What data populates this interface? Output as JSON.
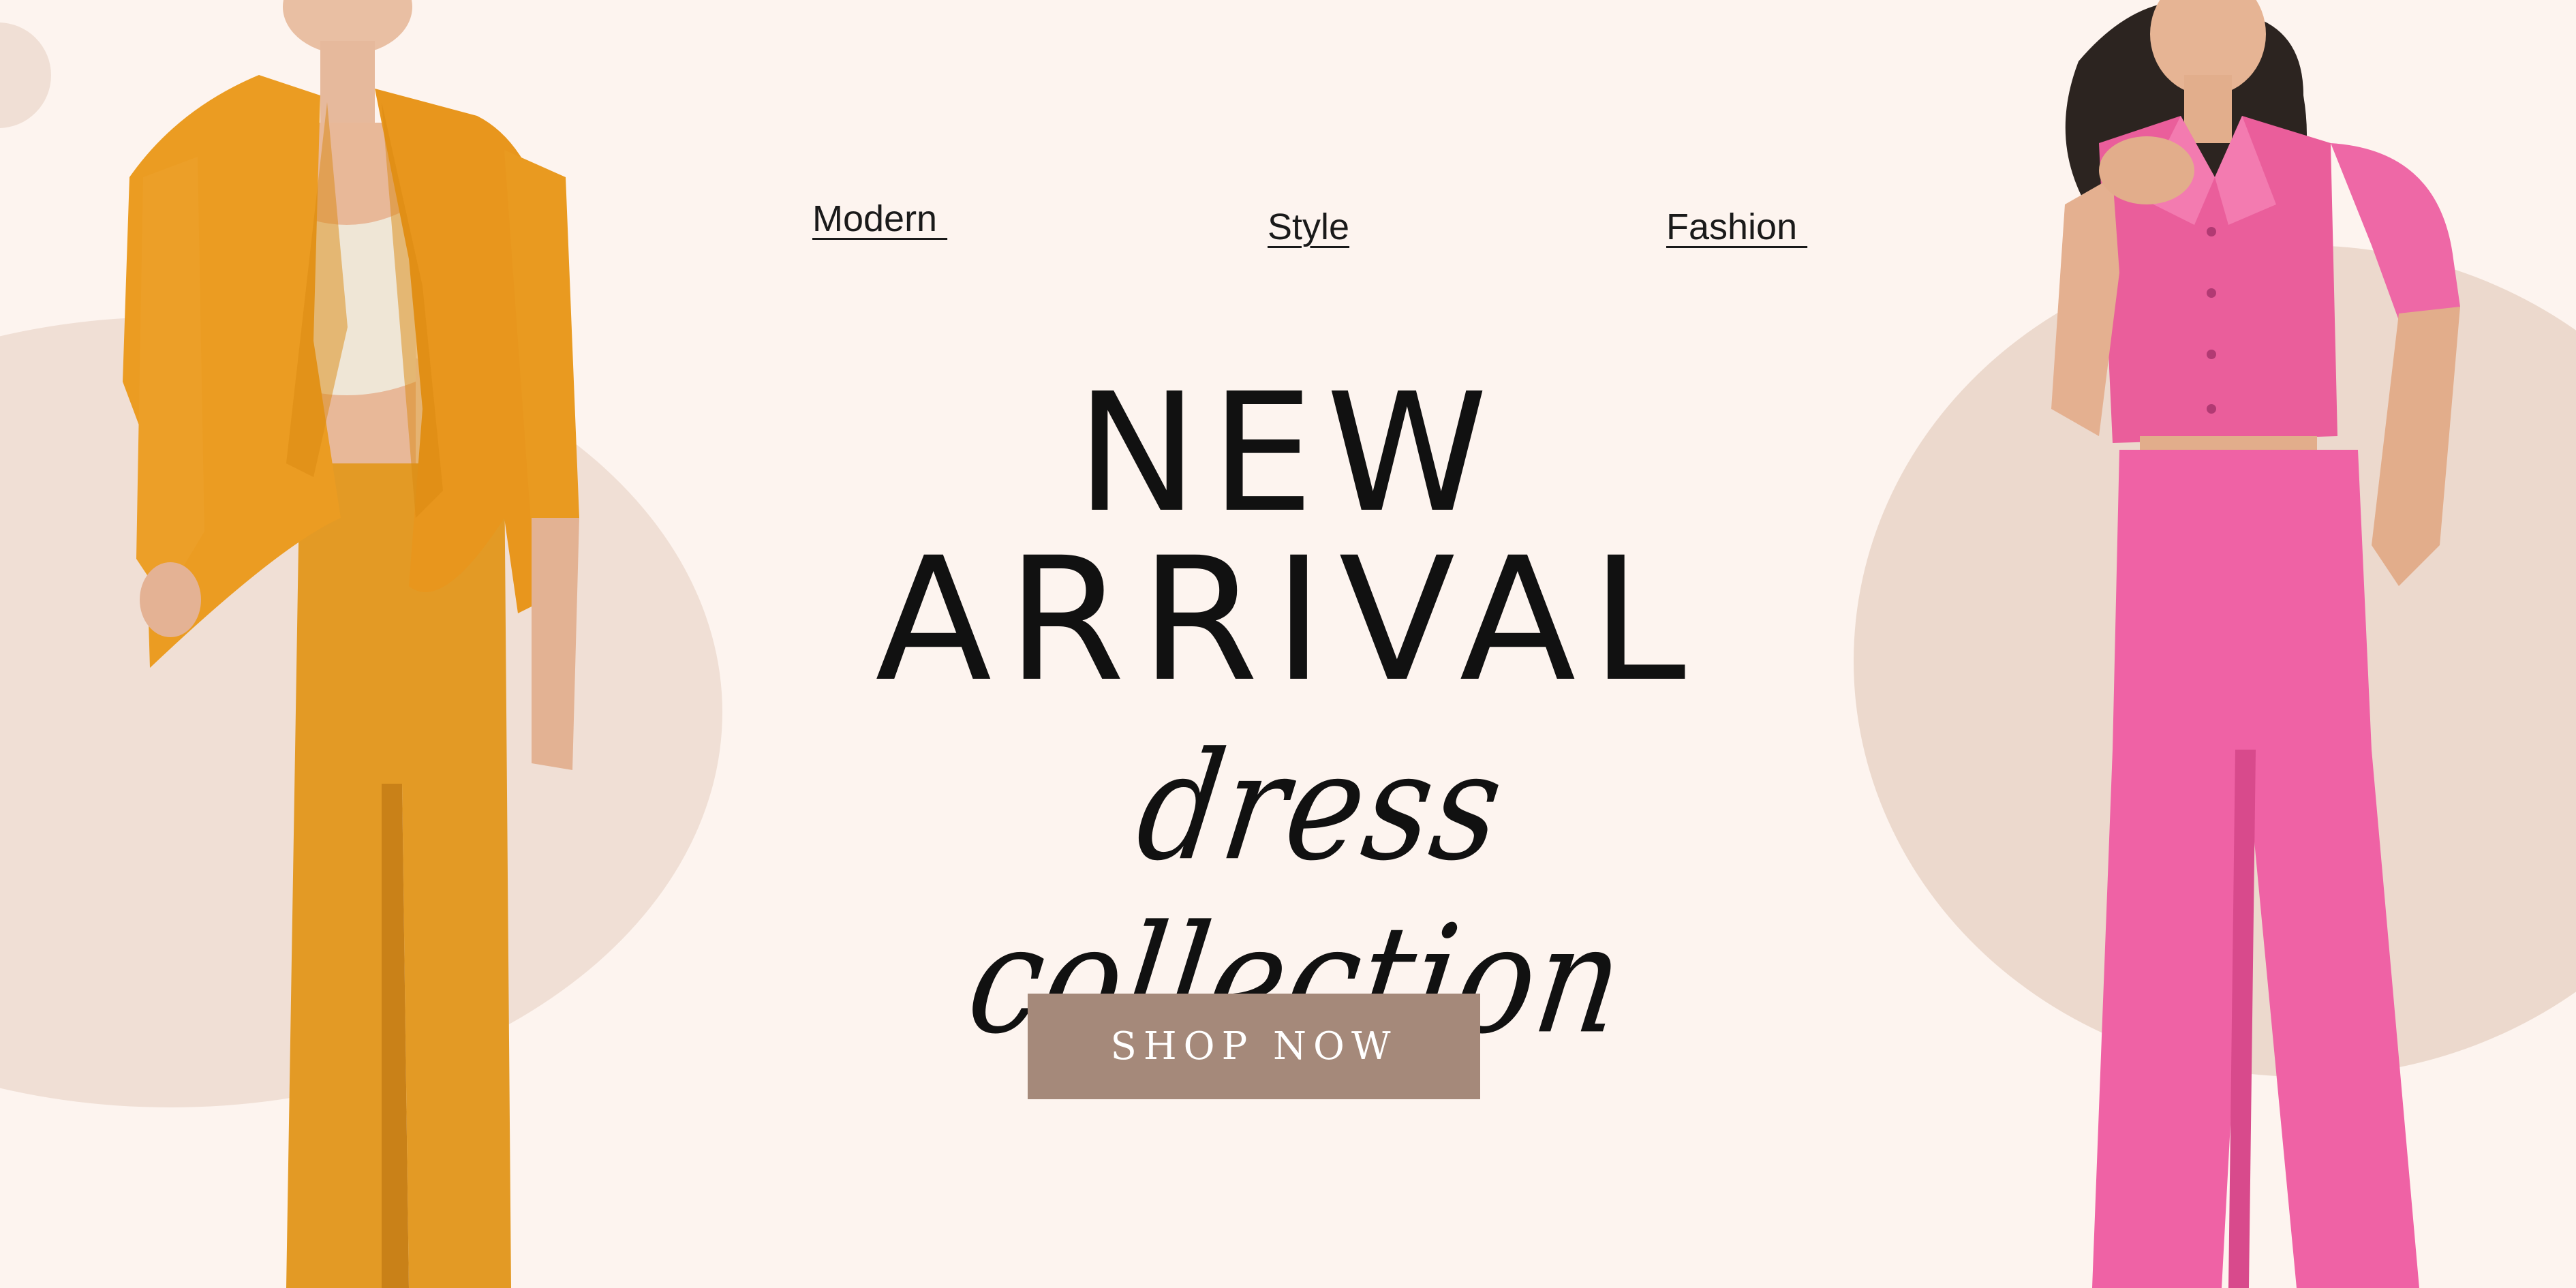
{
  "nav": {
    "modern": "Modern ",
    "style": "Style",
    "fashion": "Fashion "
  },
  "hero": {
    "headline_line1": "NEW",
    "headline_line2": "ARRIVAL",
    "subtitle": "dress collection",
    "cta_label": "SHOP NOW"
  },
  "colors": {
    "background": "#fdf4ef",
    "circle": "#f0dfd5",
    "button": "#a5897a",
    "left_outfit": "#e79a22",
    "right_outfit": "#ef5fa1"
  }
}
